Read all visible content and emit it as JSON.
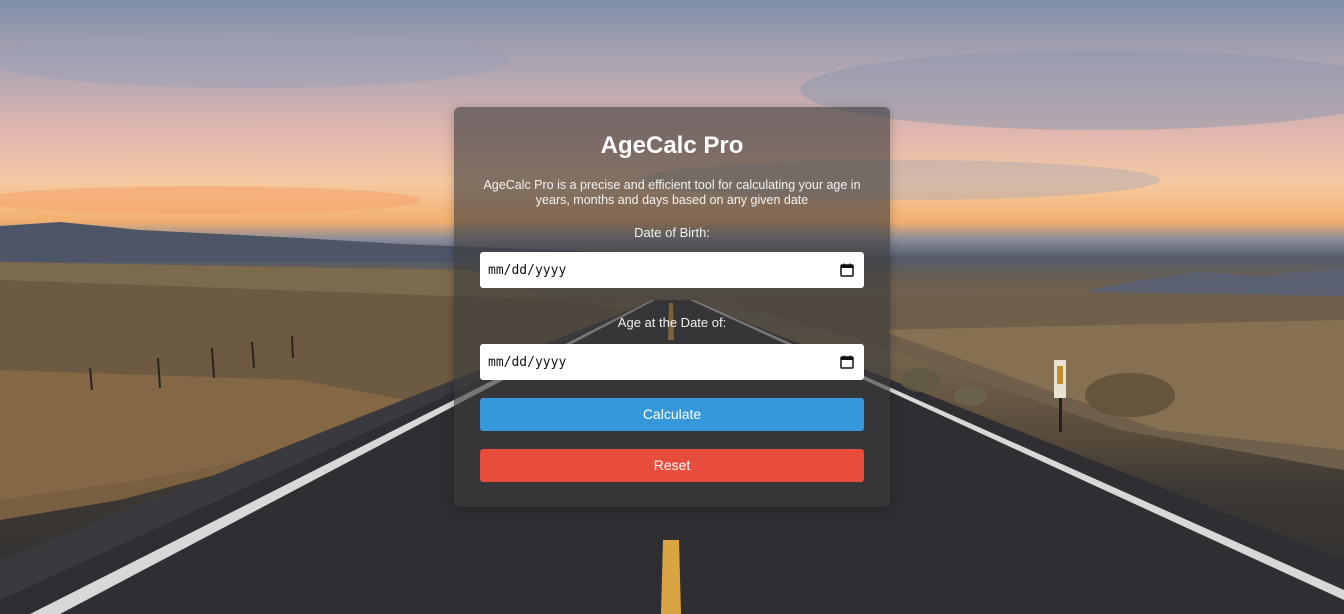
{
  "app": {
    "title": "AgeCalc Pro",
    "description": "AgeCalc Pro is a precise and efficient tool for calculating your age in years, months and days based on any given date"
  },
  "form": {
    "dob_label": "Date of Birth:",
    "dob_value": "mm/dd/yyyy",
    "target_label": "Age at the Date of:",
    "target_value": "mm/dd/yyyy",
    "calculate_label": "Calculate",
    "reset_label": "Reset"
  },
  "icons": {
    "date_picker": "calendar-icon"
  },
  "colors": {
    "calculate": "#3498db",
    "reset": "#e74c3c"
  }
}
